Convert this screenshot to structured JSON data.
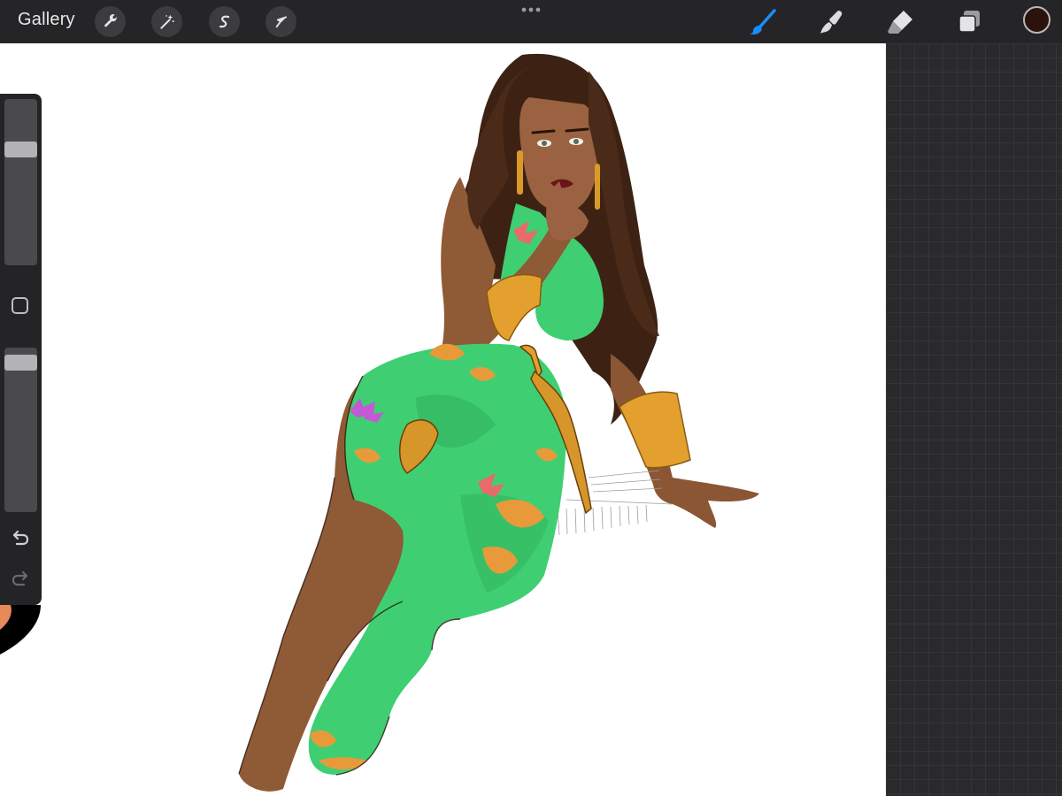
{
  "toolbar": {
    "gallery_label": "Gallery",
    "left_tools": [
      "wrench-icon",
      "magic-wand-icon",
      "selection-icon",
      "transform-arrow-icon"
    ],
    "right_tools": [
      "brush-icon",
      "smudge-icon",
      "eraser-icon",
      "layers-icon"
    ],
    "active_tool": "brush",
    "current_color": "#2b120c",
    "accent_color": "#1a8cff"
  },
  "sidebar": {
    "brush_size_level": 0.72,
    "opacity_level": 0.95,
    "controls": [
      "brush-size-slider",
      "modify-button",
      "opacity-slider",
      "undo-button",
      "redo-button"
    ]
  },
  "canvas": {
    "background": "#ffffff"
  }
}
